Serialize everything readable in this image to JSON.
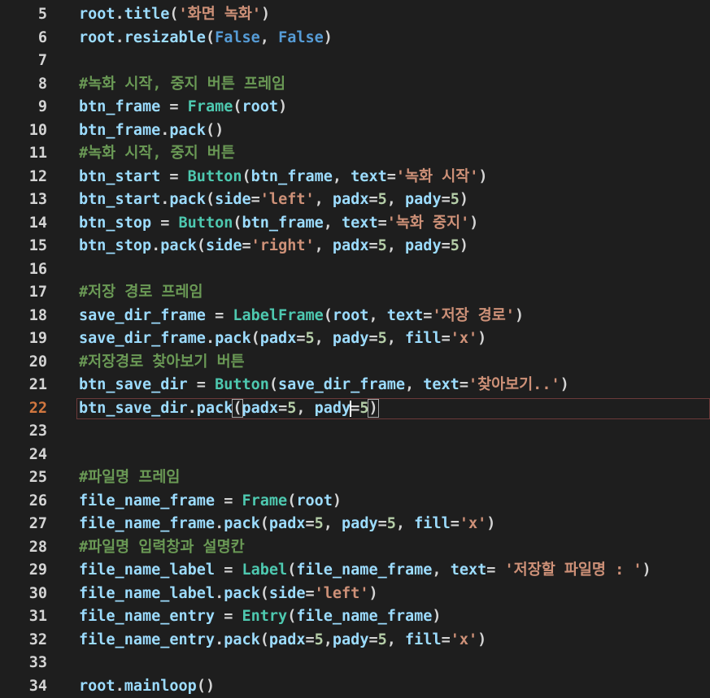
{
  "colors": {
    "background": "#1e1e1e",
    "line_number": "#d4d4d4",
    "active_line_number": "#d2773f",
    "variable": "#9cdcfe",
    "plain": "#d4d4d4",
    "class_name": "#4ec9b0",
    "string": "#ce9178",
    "number": "#b5cea8",
    "comment": "#6a9955",
    "keyword": "#569cd6",
    "current_line_border": "#6b3a3a"
  },
  "editor": {
    "active_line": 22,
    "lines": [
      {
        "number": "5",
        "tokens": [
          {
            "t": "root",
            "c": "variable"
          },
          {
            "t": ".",
            "c": "plain"
          },
          {
            "t": "title",
            "c": "variable"
          },
          {
            "t": "(",
            "c": "plain"
          },
          {
            "t": "'화면 녹화'",
            "c": "string"
          },
          {
            "t": ")",
            "c": "plain"
          }
        ]
      },
      {
        "number": "6",
        "tokens": [
          {
            "t": "root",
            "c": "variable"
          },
          {
            "t": ".",
            "c": "plain"
          },
          {
            "t": "resizable",
            "c": "variable"
          },
          {
            "t": "(",
            "c": "plain"
          },
          {
            "t": "False",
            "c": "keyword"
          },
          {
            "t": ", ",
            "c": "plain"
          },
          {
            "t": "False",
            "c": "keyword"
          },
          {
            "t": ")",
            "c": "plain"
          }
        ]
      },
      {
        "number": "7",
        "tokens": []
      },
      {
        "number": "8",
        "tokens": [
          {
            "t": "#녹화 시작, 중지 버튼 프레임",
            "c": "comment"
          }
        ]
      },
      {
        "number": "9",
        "tokens": [
          {
            "t": "btn_frame",
            "c": "variable"
          },
          {
            "t": " = ",
            "c": "plain"
          },
          {
            "t": "Frame",
            "c": "class_name"
          },
          {
            "t": "(",
            "c": "plain"
          },
          {
            "t": "root",
            "c": "variable"
          },
          {
            "t": ")",
            "c": "plain"
          }
        ]
      },
      {
        "number": "10",
        "tokens": [
          {
            "t": "btn_frame",
            "c": "variable"
          },
          {
            "t": ".",
            "c": "plain"
          },
          {
            "t": "pack",
            "c": "variable"
          },
          {
            "t": "()",
            "c": "plain"
          }
        ]
      },
      {
        "number": "11",
        "tokens": [
          {
            "t": "#녹화 시작, 중지 버튼",
            "c": "comment"
          }
        ]
      },
      {
        "number": "12",
        "tokens": [
          {
            "t": "btn_start",
            "c": "variable"
          },
          {
            "t": " = ",
            "c": "plain"
          },
          {
            "t": "Button",
            "c": "class_name"
          },
          {
            "t": "(",
            "c": "plain"
          },
          {
            "t": "btn_frame",
            "c": "variable"
          },
          {
            "t": ", ",
            "c": "plain"
          },
          {
            "t": "text",
            "c": "variable"
          },
          {
            "t": "=",
            "c": "plain"
          },
          {
            "t": "'녹화 시작'",
            "c": "string"
          },
          {
            "t": ")",
            "c": "plain"
          }
        ]
      },
      {
        "number": "13",
        "tokens": [
          {
            "t": "btn_start",
            "c": "variable"
          },
          {
            "t": ".",
            "c": "plain"
          },
          {
            "t": "pack",
            "c": "variable"
          },
          {
            "t": "(",
            "c": "plain"
          },
          {
            "t": "side",
            "c": "variable"
          },
          {
            "t": "=",
            "c": "plain"
          },
          {
            "t": "'left'",
            "c": "string"
          },
          {
            "t": ", ",
            "c": "plain"
          },
          {
            "t": "padx",
            "c": "variable"
          },
          {
            "t": "=",
            "c": "plain"
          },
          {
            "t": "5",
            "c": "number"
          },
          {
            "t": ", ",
            "c": "plain"
          },
          {
            "t": "pady",
            "c": "variable"
          },
          {
            "t": "=",
            "c": "plain"
          },
          {
            "t": "5",
            "c": "number"
          },
          {
            "t": ")",
            "c": "plain"
          }
        ]
      },
      {
        "number": "14",
        "tokens": [
          {
            "t": "btn_stop",
            "c": "variable"
          },
          {
            "t": " = ",
            "c": "plain"
          },
          {
            "t": "Button",
            "c": "class_name"
          },
          {
            "t": "(",
            "c": "plain"
          },
          {
            "t": "btn_frame",
            "c": "variable"
          },
          {
            "t": ", ",
            "c": "plain"
          },
          {
            "t": "text",
            "c": "variable"
          },
          {
            "t": "=",
            "c": "plain"
          },
          {
            "t": "'녹화 중지'",
            "c": "string"
          },
          {
            "t": ")",
            "c": "plain"
          }
        ]
      },
      {
        "number": "15",
        "tokens": [
          {
            "t": "btn_stop",
            "c": "variable"
          },
          {
            "t": ".",
            "c": "plain"
          },
          {
            "t": "pack",
            "c": "variable"
          },
          {
            "t": "(",
            "c": "plain"
          },
          {
            "t": "side",
            "c": "variable"
          },
          {
            "t": "=",
            "c": "plain"
          },
          {
            "t": "'right'",
            "c": "string"
          },
          {
            "t": ", ",
            "c": "plain"
          },
          {
            "t": "padx",
            "c": "variable"
          },
          {
            "t": "=",
            "c": "plain"
          },
          {
            "t": "5",
            "c": "number"
          },
          {
            "t": ", ",
            "c": "plain"
          },
          {
            "t": "pady",
            "c": "variable"
          },
          {
            "t": "=",
            "c": "plain"
          },
          {
            "t": "5",
            "c": "number"
          },
          {
            "t": ")",
            "c": "plain"
          }
        ]
      },
      {
        "number": "16",
        "tokens": []
      },
      {
        "number": "17",
        "tokens": [
          {
            "t": "#저장 경로 프레임",
            "c": "comment"
          }
        ]
      },
      {
        "number": "18",
        "tokens": [
          {
            "t": "save_dir_frame",
            "c": "variable"
          },
          {
            "t": " = ",
            "c": "plain"
          },
          {
            "t": "LabelFrame",
            "c": "class_name"
          },
          {
            "t": "(",
            "c": "plain"
          },
          {
            "t": "root",
            "c": "variable"
          },
          {
            "t": ", ",
            "c": "plain"
          },
          {
            "t": "text",
            "c": "variable"
          },
          {
            "t": "=",
            "c": "plain"
          },
          {
            "t": "'저장 경로'",
            "c": "string"
          },
          {
            "t": ")",
            "c": "plain"
          }
        ]
      },
      {
        "number": "19",
        "tokens": [
          {
            "t": "save_dir_frame",
            "c": "variable"
          },
          {
            "t": ".",
            "c": "plain"
          },
          {
            "t": "pack",
            "c": "variable"
          },
          {
            "t": "(",
            "c": "plain"
          },
          {
            "t": "padx",
            "c": "variable"
          },
          {
            "t": "=",
            "c": "plain"
          },
          {
            "t": "5",
            "c": "number"
          },
          {
            "t": ", ",
            "c": "plain"
          },
          {
            "t": "pady",
            "c": "variable"
          },
          {
            "t": "=",
            "c": "plain"
          },
          {
            "t": "5",
            "c": "number"
          },
          {
            "t": ", ",
            "c": "plain"
          },
          {
            "t": "fill",
            "c": "variable"
          },
          {
            "t": "=",
            "c": "plain"
          },
          {
            "t": "'x'",
            "c": "string"
          },
          {
            "t": ")",
            "c": "plain"
          }
        ]
      },
      {
        "number": "20",
        "tokens": [
          {
            "t": "#저장경로 찾아보기 버튼",
            "c": "comment"
          }
        ]
      },
      {
        "number": "21",
        "tokens": [
          {
            "t": "btn_save_dir",
            "c": "variable"
          },
          {
            "t": " = ",
            "c": "plain"
          },
          {
            "t": "Button",
            "c": "class_name"
          },
          {
            "t": "(",
            "c": "plain"
          },
          {
            "t": "save_dir_frame",
            "c": "variable"
          },
          {
            "t": ", ",
            "c": "plain"
          },
          {
            "t": "text",
            "c": "variable"
          },
          {
            "t": "=",
            "c": "plain"
          },
          {
            "t": "'찾아보기..'",
            "c": "string"
          },
          {
            "t": ")",
            "c": "plain"
          }
        ]
      },
      {
        "number": "22",
        "tokens": [
          {
            "t": "btn_save_dir",
            "c": "variable"
          },
          {
            "t": ".",
            "c": "plain"
          },
          {
            "t": "pack",
            "c": "variable"
          },
          {
            "t": "(",
            "c": "plain",
            "m": true
          },
          {
            "t": "padx",
            "c": "variable"
          },
          {
            "t": "=",
            "c": "plain"
          },
          {
            "t": "5",
            "c": "number"
          },
          {
            "t": ", ",
            "c": "plain"
          },
          {
            "t": "pady",
            "c": "variable"
          },
          {
            "t": "",
            "c": "cursor"
          },
          {
            "t": "=",
            "c": "plain"
          },
          {
            "t": "5",
            "c": "number"
          },
          {
            "t": ")",
            "c": "plain",
            "m": true
          }
        ]
      },
      {
        "number": "23",
        "tokens": []
      },
      {
        "number": "24",
        "tokens": []
      },
      {
        "number": "25",
        "tokens": [
          {
            "t": "#파일명 프레임",
            "c": "comment"
          }
        ]
      },
      {
        "number": "26",
        "tokens": [
          {
            "t": "file_name_frame",
            "c": "variable"
          },
          {
            "t": " = ",
            "c": "plain"
          },
          {
            "t": "Frame",
            "c": "class_name"
          },
          {
            "t": "(",
            "c": "plain"
          },
          {
            "t": "root",
            "c": "variable"
          },
          {
            "t": ")",
            "c": "plain"
          }
        ]
      },
      {
        "number": "27",
        "tokens": [
          {
            "t": "file_name_frame",
            "c": "variable"
          },
          {
            "t": ".",
            "c": "plain"
          },
          {
            "t": "pack",
            "c": "variable"
          },
          {
            "t": "(",
            "c": "plain"
          },
          {
            "t": "padx",
            "c": "variable"
          },
          {
            "t": "=",
            "c": "plain"
          },
          {
            "t": "5",
            "c": "number"
          },
          {
            "t": ", ",
            "c": "plain"
          },
          {
            "t": "pady",
            "c": "variable"
          },
          {
            "t": "=",
            "c": "plain"
          },
          {
            "t": "5",
            "c": "number"
          },
          {
            "t": ", ",
            "c": "plain"
          },
          {
            "t": "fill",
            "c": "variable"
          },
          {
            "t": "=",
            "c": "plain"
          },
          {
            "t": "'x'",
            "c": "string"
          },
          {
            "t": ")",
            "c": "plain"
          }
        ]
      },
      {
        "number": "28",
        "tokens": [
          {
            "t": "#파일명 입력창과 설명칸",
            "c": "comment"
          }
        ]
      },
      {
        "number": "29",
        "tokens": [
          {
            "t": "file_name_label",
            "c": "variable"
          },
          {
            "t": " = ",
            "c": "plain"
          },
          {
            "t": "Label",
            "c": "class_name"
          },
          {
            "t": "(",
            "c": "plain"
          },
          {
            "t": "file_name_frame",
            "c": "variable"
          },
          {
            "t": ", ",
            "c": "plain"
          },
          {
            "t": "text",
            "c": "variable"
          },
          {
            "t": "= ",
            "c": "plain"
          },
          {
            "t": "'저장할 파일명 : '",
            "c": "string"
          },
          {
            "t": ")",
            "c": "plain"
          }
        ]
      },
      {
        "number": "30",
        "tokens": [
          {
            "t": "file_name_label",
            "c": "variable"
          },
          {
            "t": ".",
            "c": "plain"
          },
          {
            "t": "pack",
            "c": "variable"
          },
          {
            "t": "(",
            "c": "plain"
          },
          {
            "t": "side",
            "c": "variable"
          },
          {
            "t": "=",
            "c": "plain"
          },
          {
            "t": "'left'",
            "c": "string"
          },
          {
            "t": ")",
            "c": "plain"
          }
        ]
      },
      {
        "number": "31",
        "tokens": [
          {
            "t": "file_name_entry",
            "c": "variable"
          },
          {
            "t": " = ",
            "c": "plain"
          },
          {
            "t": "Entry",
            "c": "class_name"
          },
          {
            "t": "(",
            "c": "plain"
          },
          {
            "t": "file_name_frame",
            "c": "variable"
          },
          {
            "t": ")",
            "c": "plain"
          }
        ]
      },
      {
        "number": "32",
        "tokens": [
          {
            "t": "file_name_entry",
            "c": "variable"
          },
          {
            "t": ".",
            "c": "plain"
          },
          {
            "t": "pack",
            "c": "variable"
          },
          {
            "t": "(",
            "c": "plain"
          },
          {
            "t": "padx",
            "c": "variable"
          },
          {
            "t": "=",
            "c": "plain"
          },
          {
            "t": "5",
            "c": "number"
          },
          {
            "t": ",",
            "c": "plain"
          },
          {
            "t": "pady",
            "c": "variable"
          },
          {
            "t": "=",
            "c": "plain"
          },
          {
            "t": "5",
            "c": "number"
          },
          {
            "t": ", ",
            "c": "plain"
          },
          {
            "t": "fill",
            "c": "variable"
          },
          {
            "t": "=",
            "c": "plain"
          },
          {
            "t": "'x'",
            "c": "string"
          },
          {
            "t": ")",
            "c": "plain"
          }
        ]
      },
      {
        "number": "33",
        "tokens": []
      },
      {
        "number": "34",
        "tokens": [
          {
            "t": "root",
            "c": "variable"
          },
          {
            "t": ".",
            "c": "plain"
          },
          {
            "t": "mainloop",
            "c": "variable"
          },
          {
            "t": "()",
            "c": "plain"
          }
        ]
      }
    ]
  }
}
